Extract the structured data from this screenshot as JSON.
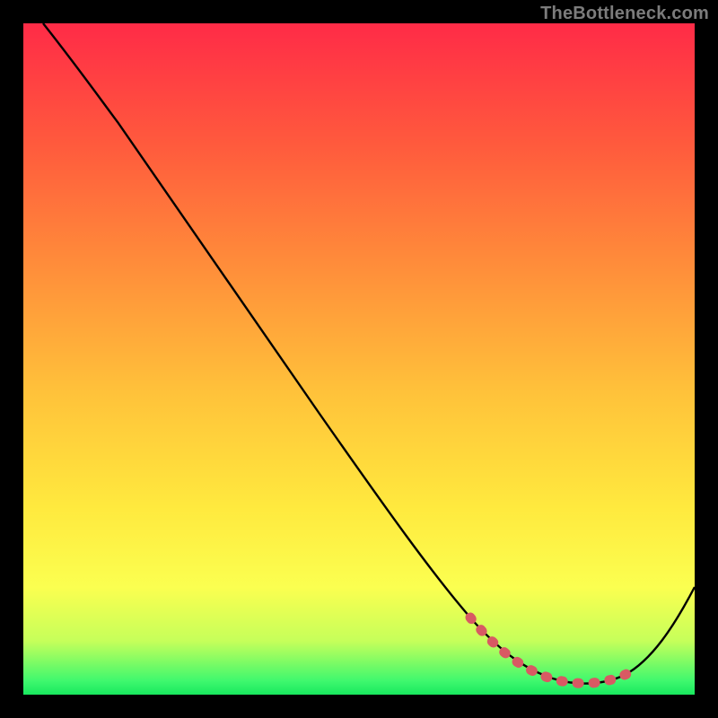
{
  "watermark": "TheBottleneck.com",
  "colors": {
    "frame": "#000000",
    "curve": "#000000",
    "marker": "#d85a63",
    "gradient_top": "#ff2b47",
    "gradient_bottom": "#18e85e"
  },
  "chart_data": {
    "type": "line",
    "title": "",
    "xlabel": "",
    "ylabel": "",
    "xlim": [
      0,
      100
    ],
    "ylim": [
      0,
      100
    ],
    "series": [
      {
        "name": "bottleneck-curve",
        "x": [
          3,
          8,
          14,
          20,
          26,
          32,
          38,
          44,
          50,
          56,
          62,
          66,
          70,
          74,
          78,
          82,
          86,
          90,
          94,
          98,
          100
        ],
        "y": [
          100,
          94,
          87,
          79,
          71,
          63,
          55,
          47,
          39,
          31,
          23,
          17,
          12,
          8,
          5,
          3,
          2,
          2,
          5,
          12,
          17
        ]
      }
    ],
    "highlight_region": {
      "description": "low-bottleneck flat valley, dotted pink markers",
      "x": [
        70,
        74,
        78,
        82,
        86,
        90
      ],
      "y": [
        12,
        8,
        5,
        3,
        2,
        2
      ]
    }
  }
}
